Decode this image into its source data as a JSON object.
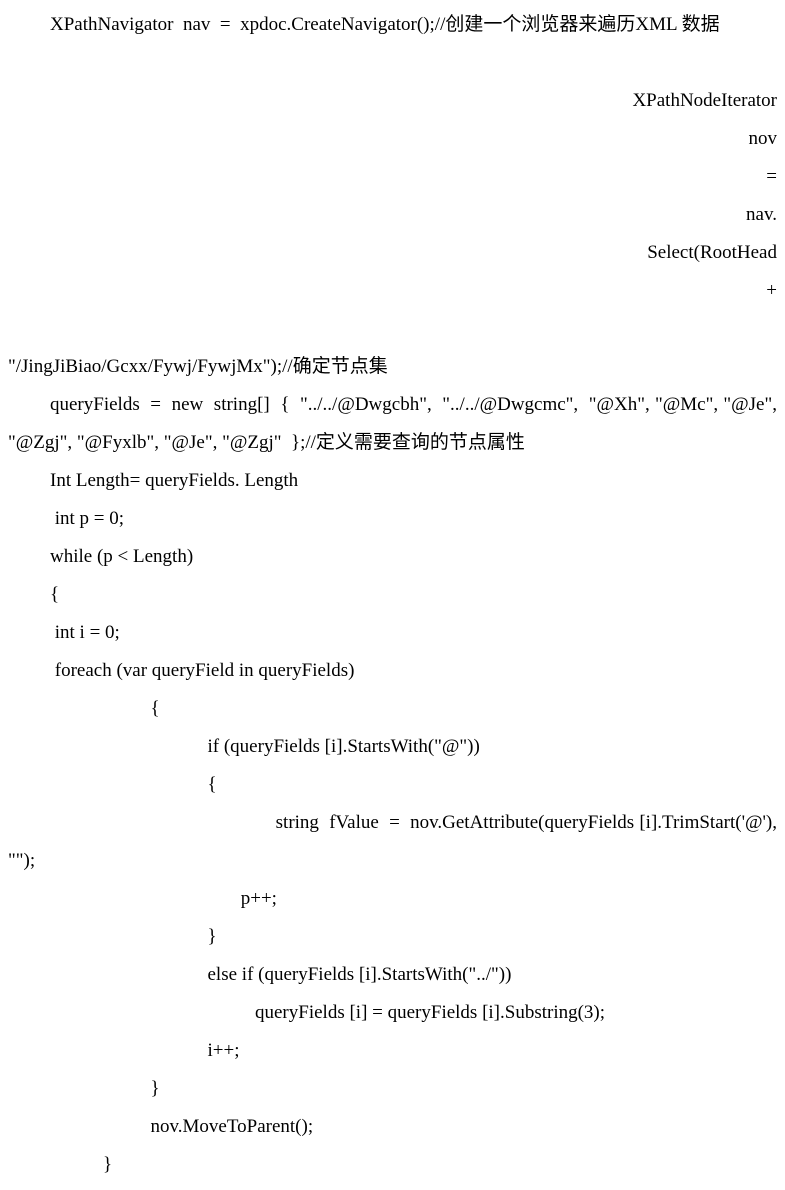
{
  "code": {
    "l1": "XPathNavigator  nav  =  xpdoc.CreateNavigator();//创建一个浏览器来遍历XML 数据",
    "l2a": "XPathNodeIterator",
    "l2b": "nov",
    "l2c": "=",
    "l2d": "nav.",
    "l2e": "Select(RootHead",
    "l2f": "+",
    "l3": "\"/JingJiBiao/Gcxx/Fywj/FywjMx\");//确定节点集",
    "l4": "queryFields  =  new  string[]  {  \"../../@Dwgcbh\",  \"../../@Dwgcmc\",  \"@Xh\", \"@Mc\", \"@Je\", \"@Zgj\", \"@Fyxlb\", \"@Je\", \"@Zgj\"  };//定义需要查询的节点属性",
    "l5": "Int Length= queryFields. Length",
    "l6": " int p = 0;",
    "l7": "while (p < Length)",
    "l8": "{",
    "l9": " int i = 0;",
    "l10": " foreach (var queryField in queryFields)",
    "l11": "                              {",
    "l12": "                                          if (queryFields [i].StartsWith(\"@\"))",
    "l13": "                                          {",
    "l14": "                                                    string  fValue  =  nov.GetAttribute(queryFields [i].TrimStart('@'), \"\");",
    "l15": "                                                 p++;",
    "l16": "                                          }",
    "l17": "                                          else if (queryFields [i].StartsWith(\"../\"))",
    "l18": "                                                    queryFields [i] = queryFields [i].Substring(3);",
    "l19": "                                          i++;",
    "l20": "                              }",
    "l21": "                              nov.MoveToParent();",
    "l22": "                    }"
  }
}
